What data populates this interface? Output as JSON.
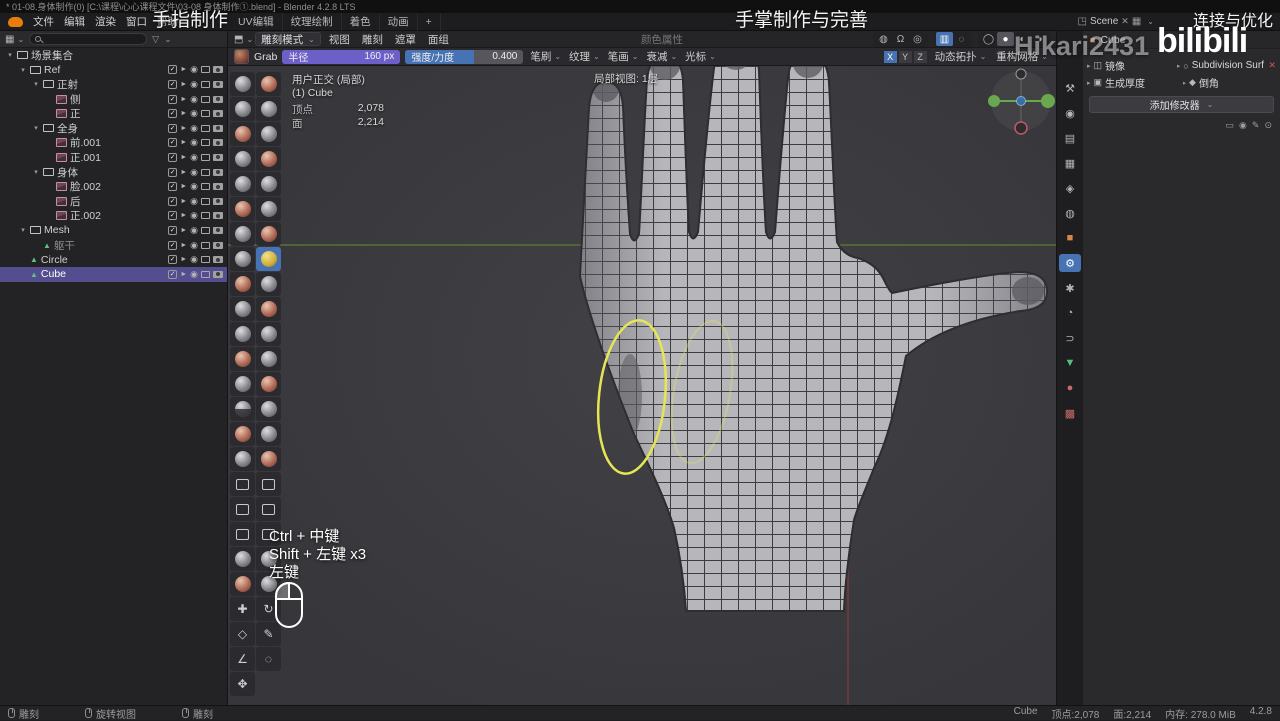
{
  "titlebar": {
    "title": "* 01-08.身体制作(0) [C:\\课程\\心心课程文件\\03-08 身体制作①.blend] - Blender 4.2.8 LTS"
  },
  "menubar": {
    "menus": [
      "文件",
      "编辑",
      "渲染",
      "窗口",
      "帮助"
    ],
    "workspaces": [
      "UV编辑",
      "纹理绘制",
      "着色",
      "动画",
      "+"
    ],
    "scene_label": "Scene"
  },
  "overlays": {
    "caption_left": "手指制作",
    "caption_center": "手掌制作与完善",
    "caption_right": "连接与优化",
    "watermark_user": "Hikari2431",
    "watermark_brand": "bilibili",
    "hints": [
      "Ctrl + 中键",
      "Shift + 左键 x3",
      "左键"
    ]
  },
  "outliner": {
    "rows": [
      {
        "label": "场景集合",
        "level": 0,
        "icon": "collection",
        "tools": false
      },
      {
        "label": "Ref",
        "level": 1,
        "icon": "collection"
      },
      {
        "label": "正射",
        "level": 2,
        "icon": "collection"
      },
      {
        "label": "侧",
        "level": 3,
        "icon": "image"
      },
      {
        "label": "正",
        "level": 3,
        "icon": "image"
      },
      {
        "label": "全身",
        "level": 2,
        "icon": "collection"
      },
      {
        "label": "前.001",
        "level": 3,
        "icon": "image"
      },
      {
        "label": "正.001",
        "level": 3,
        "icon": "image"
      },
      {
        "label": "身体",
        "level": 2,
        "icon": "collection"
      },
      {
        "label": "脸.002",
        "level": 3,
        "icon": "image"
      },
      {
        "label": "后",
        "level": 3,
        "icon": "image"
      },
      {
        "label": "正.002",
        "level": 3,
        "icon": "image"
      },
      {
        "label": "Mesh",
        "level": 1,
        "icon": "collection"
      },
      {
        "label": "躯干",
        "level": 2,
        "icon": "mesh",
        "dim": true
      },
      {
        "label": "Circle",
        "level": 1,
        "icon": "mesh"
      },
      {
        "label": "Cube",
        "level": 1,
        "icon": "mesh",
        "selected": true
      }
    ]
  },
  "viewport": {
    "mode": "雕刻模式",
    "menus": [
      "视图",
      "雕刻",
      "遮罩",
      "面组"
    ],
    "disabled_menu": "颜色属性",
    "tool_settings": {
      "tool_name": "Grab",
      "radius_label": "半径",
      "radius_value": "160 px",
      "strength_label": "强度/力度",
      "strength_value": "0.400",
      "dropdowns": [
        "笔刷",
        "纹理",
        "笔画",
        "衰减",
        "光标"
      ],
      "axes": [
        "X",
        "Y",
        "Z"
      ],
      "right_dropdowns": [
        "动态拓扑",
        "重构网格"
      ]
    },
    "info": {
      "view": "用户正交 (局部)",
      "object": "(1) Cube",
      "verts_label": "顶点",
      "verts": "2,078",
      "faces_label": "面",
      "faces": "2,214"
    },
    "local_view": "局部视图: 1层"
  },
  "toolbar": {
    "active": "grab",
    "tools": [
      "draw",
      "draw-sharp",
      "clay",
      "clay-strips",
      "clay-thumb",
      "layer",
      "inflate",
      "blob",
      "crease",
      "smooth",
      "flatten",
      "fill",
      "scrape",
      "multi-plane-scrape",
      "pinch",
      "grab",
      "elastic-deform",
      "snake-hook",
      "thumb",
      "pose",
      "nudge",
      "rotate",
      "slide-relax",
      "boundary",
      "cloth",
      "simulate",
      "mask",
      "draw-face-sets",
      "multires-eraser",
      "multires-smear",
      "paint",
      "smear",
      "box-mask",
      "box-hide",
      "box-face-set",
      "box-trim",
      "line-trim",
      "line-project",
      "mesh-filter",
      "cloth-filter",
      "color-filter",
      "edit-face-set",
      "move",
      "rotate-tool",
      "transform",
      "annotate",
      "measure",
      "zoom",
      "pan"
    ]
  },
  "properties": {
    "tabs": [
      "tool",
      "render",
      "output",
      "view-layer",
      "scene",
      "world",
      "object",
      "modifiers",
      "particles",
      "physics",
      "constraints",
      "object-data",
      "material",
      "texture"
    ],
    "active_tab": "modifiers",
    "breadcrumb": "Cube",
    "modifier_names": [
      "镜像",
      "Subdivision Surface",
      "生成厚度",
      "倒角"
    ],
    "add_modifier": "添加修改器"
  },
  "statusbar": {
    "left": [
      "雕刻",
      "旋转视图",
      "雕刻"
    ],
    "right": [
      "Cube",
      "顶点:2,078",
      "面:2,214",
      "内存: 278.0 MiB",
      "4.2.8"
    ]
  }
}
